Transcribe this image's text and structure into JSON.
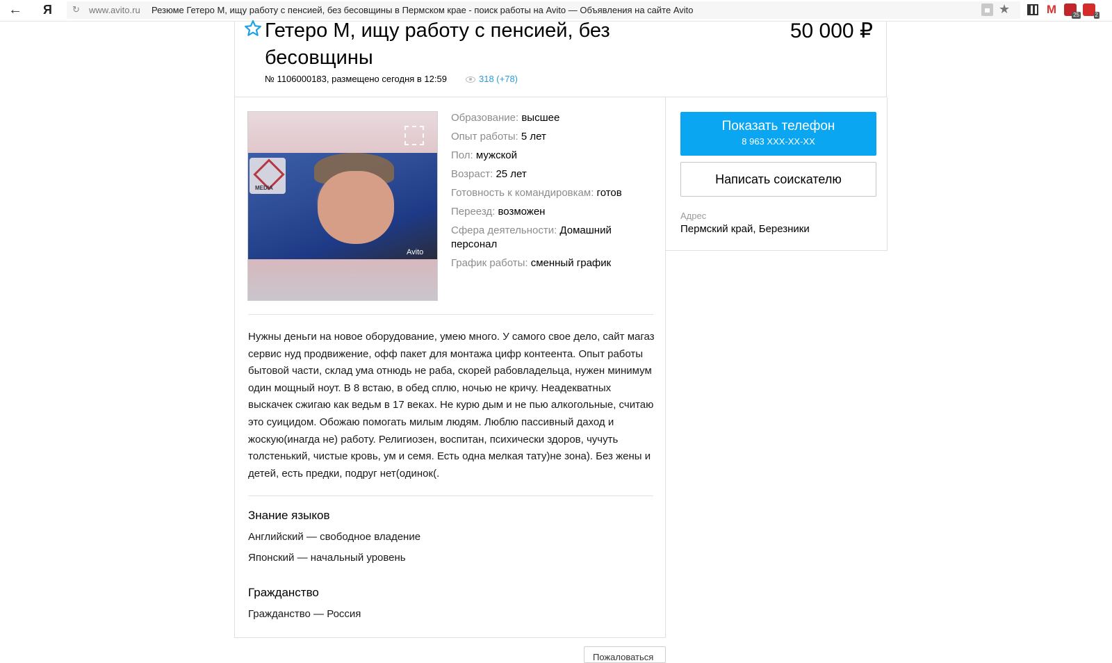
{
  "browser": {
    "back_icon": "←",
    "yandex_logo": "Я",
    "reload_icon": "↻",
    "domain": "www.avito.ru",
    "tab_title": "Резюме Гетеро М, ищу работу с пенсией, без бесовщины в Пермском крае - поиск работы на Avito — Объявления на сайте Avito",
    "star_icon": "★",
    "gmail_icon": "M",
    "ext_badge_1": "25",
    "ext_badge_2": "2"
  },
  "listing": {
    "title": "Гетеро М, ищу работу с пенсией, без бесовщины",
    "price": "50 000 ₽",
    "meta": "№ 1106000183, размещено сегодня в 12:59",
    "views": "318 (+78)"
  },
  "photo": {
    "watermark": "Avito"
  },
  "params": [
    {
      "label": "Образование:",
      "value": "высшее"
    },
    {
      "label": "Опыт работы:",
      "value": "5 лет"
    },
    {
      "label": "Пол:",
      "value": "мужской"
    },
    {
      "label": "Возраст:",
      "value": "25 лет"
    },
    {
      "label": "Готовность к командировкам:",
      "value": "готов"
    },
    {
      "label": "Переезд:",
      "value": "возможен"
    },
    {
      "label": "Сфера деятельности:",
      "value": "Домашний персонал"
    },
    {
      "label": "График работы:",
      "value": "сменный график"
    }
  ],
  "description": "Нужны деньги на новое оборудование, умею много. У самого свое дело, сайт магаз сервис нуд продвижение, офф пакет для монтажа цифр контеента. Опыт работы бытовой части, склад ума отнюдь не раба, скорей рабовладельца, нужен минимум один мощный ноут. В 8 встаю, в обед сплю, ночью не кричу. Неадекватных выскачек сжигаю как ведьм в 17 веках. Не курю дым и не пью алкогольные, считаю это суицидом. Обожаю помогать милым людям. Люблю пассивный даход и жоскую(инагда не) работу. Религиозен, воспитан, психически здоров, чучуть толстенький, чистые кровь, ум и семя. Есть одна мелкая тату)не зона). Без жены и детей, есть предки, подруг нет(одинок(.",
  "languages": {
    "title": "Знание языков",
    "items": [
      "Английский — свободное владение",
      "Японский — начальный уровень"
    ]
  },
  "citizenship": {
    "title": "Гражданство",
    "value": "Гражданство — Россия"
  },
  "sidebar": {
    "show_phone": "Показать телефон",
    "phone_masked": "8 963 XXX-XX-XX",
    "write_button": "Написать соискателю",
    "address_label": "Адрес",
    "address_value": "Пермский край, Березники"
  },
  "footer": {
    "report_button": "Пожаловаться"
  },
  "colors": {
    "accent_blue": "#0aa6f2",
    "link_blue": "#2a9bd8",
    "label_gray": "#8c8c8c"
  }
}
